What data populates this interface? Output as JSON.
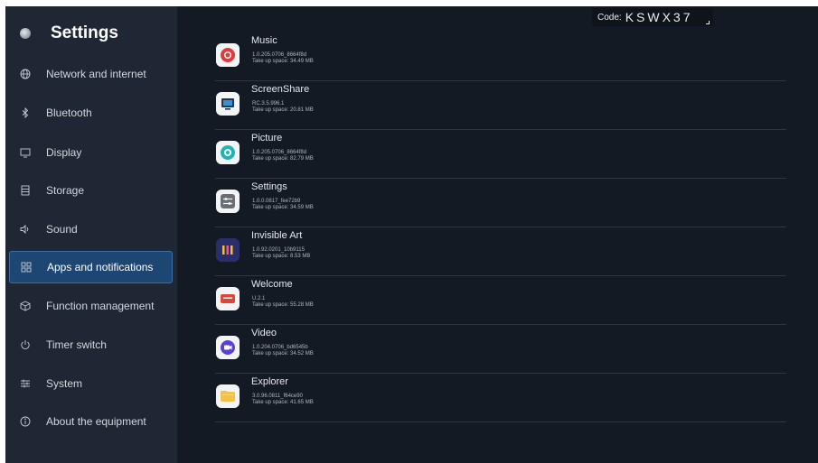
{
  "header": {
    "title": "Settings"
  },
  "sidebar": {
    "items": [
      {
        "label": "Network and internet",
        "icon": "globe-icon"
      },
      {
        "label": "Bluetooth",
        "icon": "bluetooth-icon"
      },
      {
        "label": "Display",
        "icon": "monitor-icon"
      },
      {
        "label": "Storage",
        "icon": "storage-icon"
      },
      {
        "label": "Sound",
        "icon": "speaker-icon"
      },
      {
        "label": "Apps and notifications",
        "icon": "apps-grid-icon",
        "active": true
      },
      {
        "label": "Function management",
        "icon": "cube-icon"
      },
      {
        "label": "Timer switch",
        "icon": "power-icon"
      },
      {
        "label": "System",
        "icon": "sliders-icon"
      },
      {
        "label": "About the equipment",
        "icon": "info-icon"
      }
    ]
  },
  "code": {
    "label": "Code:",
    "value": "KSWX37"
  },
  "apps": [
    {
      "name": "Music",
      "version": "1.0.205.0706_8664f8d",
      "size": "Take up space: 34.49 MB",
      "icon": "music-app-icon"
    },
    {
      "name": "ScreenShare",
      "version": "RC.3.5.996.1",
      "size": "Take up space: 20.81 MB",
      "icon": "screenshare-app-icon"
    },
    {
      "name": "Picture",
      "version": "1.0.205.0706_8664f8d",
      "size": "Take up space: 82.79 MB",
      "icon": "picture-app-icon"
    },
    {
      "name": "Settings",
      "version": "1.0.0.0817_fee72b9",
      "size": "Take up space: 34.59 MB",
      "icon": "settings-app-icon"
    },
    {
      "name": "Invisible Art",
      "version": "1.0.92.0201_10b9115",
      "size": "Take up space: 8.53 MB",
      "icon": "invisible-art-app-icon"
    },
    {
      "name": "Welcome",
      "version": "U.2.1",
      "size": "Take up space: 55.28 MB",
      "icon": "welcome-app-icon"
    },
    {
      "name": "Video",
      "version": "1.0.204.0706_bd6545b",
      "size": "Take up space: 34.52 MB",
      "icon": "video-app-icon"
    },
    {
      "name": "Explorer",
      "version": "3.0.96.0811_f64ce90",
      "size": "Take up space: 41.65 MB",
      "icon": "explorer-app-icon"
    }
  ],
  "colors": {
    "background": "#141a23",
    "sidebar": "#1e2733",
    "active_item": "#1d4672",
    "divider": "#2e3642"
  }
}
